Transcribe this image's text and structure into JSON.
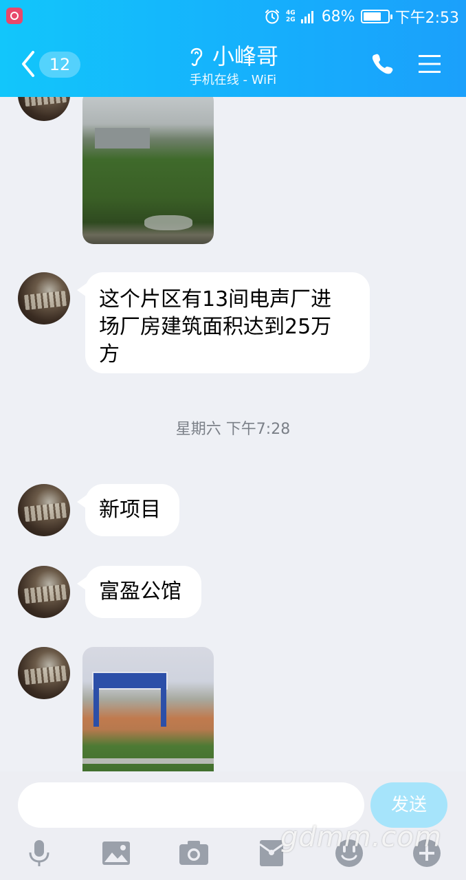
{
  "status_bar": {
    "network": "4G\n2G",
    "network_top": "4G",
    "network_bottom": "2G",
    "battery_percent": "68%",
    "battery_level": 0.68,
    "time": "下午2:53"
  },
  "header": {
    "unread_count": "12",
    "contact_name": "小峰哥",
    "contact_status": "手机在线 - WiFi"
  },
  "messages": [
    {
      "type": "image",
      "description_icon": "photo"
    },
    {
      "type": "text",
      "text": "这个片区有13间电声厂进场厂房建筑面积达到25万方"
    },
    {
      "type": "timestamp",
      "text": "星期六 下午7:28"
    },
    {
      "type": "text",
      "text": "新项目"
    },
    {
      "type": "text",
      "text": "富盈公馆"
    },
    {
      "type": "image",
      "description_icon": "photo"
    }
  ],
  "message_text": {
    "m1_line1": "这个片区有13间电声厂进",
    "m1_line2": "场厂房建筑面积达到25万",
    "m1_line3": "方",
    "timestamp": "星期六 下午7:28",
    "m2": "新项目",
    "m3": "富盈公馆"
  },
  "input": {
    "placeholder": "",
    "send_label": "发送"
  },
  "toolbar": {
    "icons": [
      "microphone-icon",
      "image-icon",
      "camera-icon",
      "red-packet-icon",
      "emoji-icon",
      "plus-icon"
    ]
  },
  "watermark": "gdmm.com",
  "colors": {
    "header_gradient_start": "#12c6fb",
    "header_gradient_end": "#1ba0fb",
    "chat_background": "#eef0f5",
    "send_button": "#a6e4fb",
    "icon_gray": "#9aa0aa"
  }
}
